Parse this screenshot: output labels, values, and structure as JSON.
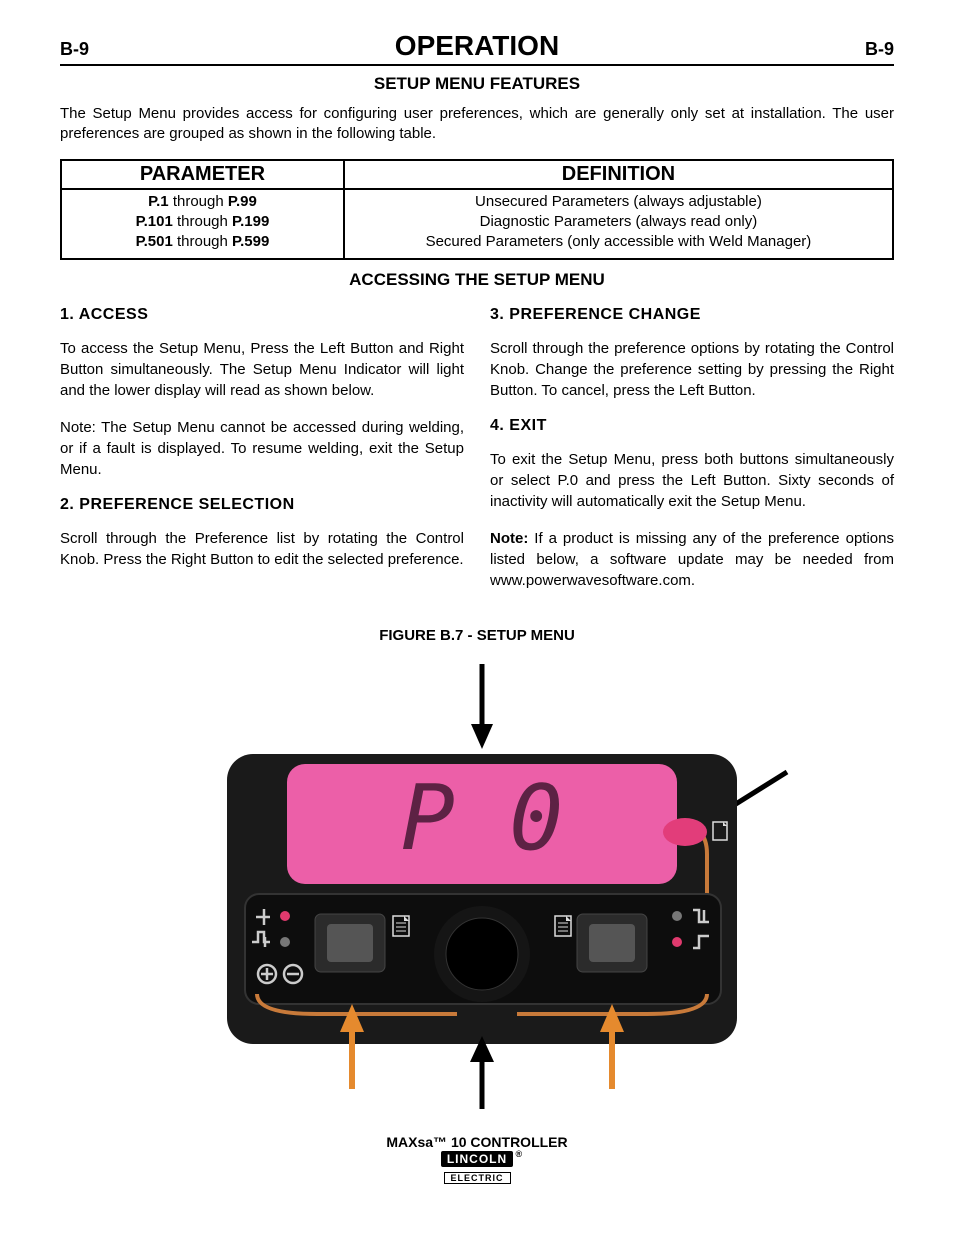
{
  "header": {
    "page_left": "B-9",
    "title": "OPERATION",
    "page_right": "B-9"
  },
  "subtitle": "SETUP MENU FEATURES",
  "intro": "The Setup Menu provides access for configuring user preferences, which are generally only set at installation. The user preferences are grouped as shown in the following table.",
  "table": {
    "head_param": "PARAMETER",
    "head_def": "DEFINITION",
    "rows": [
      {
        "p_pre": "P.1",
        "p_mid": " through ",
        "p_post": "P.99",
        "def": "Unsecured Parameters (always adjustable)"
      },
      {
        "p_pre": "P.101",
        "p_mid": " through ",
        "p_post": "P.199",
        "def": "Diagnostic Parameters (always read only)"
      },
      {
        "p_pre": "P.501",
        "p_mid": " through ",
        "p_post": "P.599",
        "def": "Secured Parameters (only accessible with Weld Manager)"
      }
    ]
  },
  "section_heading": "ACCESSING THE SETUP MENU",
  "left": {
    "s1_title": "1. ACCESS",
    "s1_p1": "To access the Setup Menu, Press the Left Button and Right Button simultaneously. The Setup Menu Indicator will light and the lower display will read as shown below.",
    "s1_p2": "Note: The Setup Menu cannot be accessed during welding, or if a fault is displayed. To resume welding, exit the Setup Menu.",
    "s2_title": "2. PREFERENCE SELECTION",
    "s2_p1": "Scroll through the Preference list by rotating the Control Knob. Press the Right Button to edit the selected preference."
  },
  "right": {
    "s3_title": "3.  PREFERENCE CHANGE",
    "s3_p1": "Scroll through the preference options by rotating the Control Knob. Change the preference setting by pressing the Right Button. To cancel, press the Left Button.",
    "s4_title": "4.  EXIT",
    "s4_p1": "To exit the Setup Menu, press both buttons simultaneously or select P.0 and press the Left Button. Sixty seconds of inactivity will automatically exit the Setup Menu.",
    "s4_note_label": "Note:",
    "s4_note_body": " If a product is missing any of the preference options listed below, a software update may be needed from www.powerwavesoftware.com."
  },
  "figure_caption": "FIGURE B.7 - SETUP MENU",
  "device": {
    "display_text": "P 0"
  },
  "footer": {
    "product": "MAXsa™ 10 CONTROLLER",
    "logo_top": "LINCOLN",
    "logo_bottom": "ELECTRIC"
  }
}
